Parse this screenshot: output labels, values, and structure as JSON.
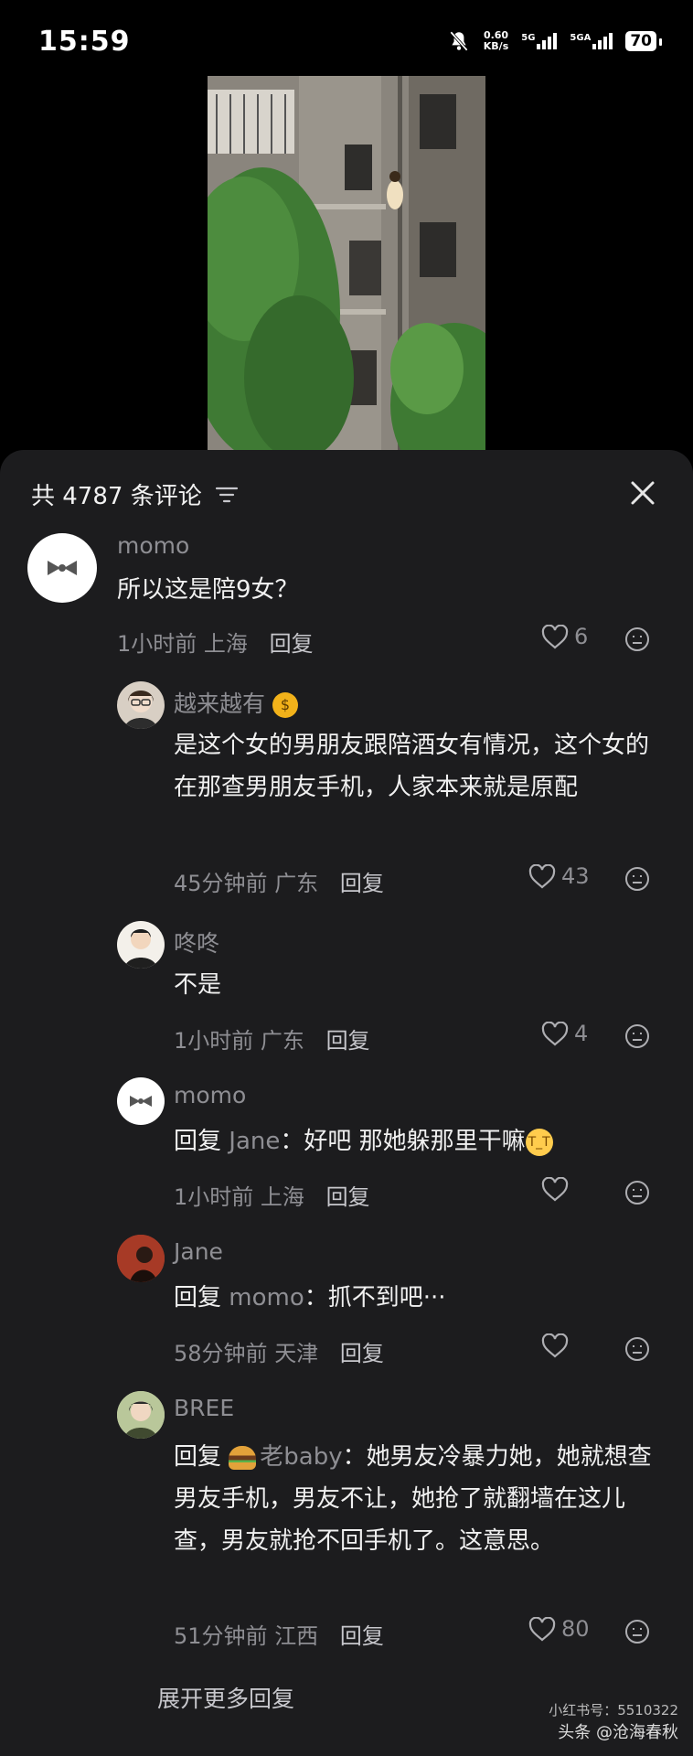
{
  "status_bar": {
    "time": "15:59",
    "net_speed_value": "0.60",
    "net_speed_unit": "KB/s",
    "sim1_label": "5G",
    "sim2_label": "5GA",
    "battery": "70"
  },
  "comments_panel": {
    "title": "共 4787 条评论"
  },
  "comments": [
    {
      "user": "momo",
      "text": "所以这是陪9女？",
      "time": "1小时前",
      "location": "上海",
      "reply_label": "回复",
      "likes": "6"
    },
    {
      "user": "越来越有",
      "text": "是这个女的男朋友跟陪酒女有情况，这个女的在那查男朋友手机，人家本来就是原配",
      "time": "45分钟前",
      "location": "广东",
      "reply_label": "回复",
      "likes": "43"
    },
    {
      "user": "咚咚",
      "text": "不是",
      "time": "1小时前",
      "location": "广东",
      "reply_label": "回复",
      "likes": "4"
    },
    {
      "user": "momo",
      "reply_prefix": "回复",
      "reply_target": "Jane",
      "text": "好吧 那她躲那里干嘛",
      "time": "1小时前",
      "location": "上海",
      "reply_label": "回复",
      "likes": ""
    },
    {
      "user": "Jane",
      "reply_prefix": "回复",
      "reply_target": "momo",
      "text": "抓不到吧···",
      "time": "58分钟前",
      "location": "天津",
      "reply_label": "回复",
      "likes": ""
    },
    {
      "user": "BREE",
      "reply_prefix": "回复",
      "reply_target": "老baby",
      "text": "她男友冷暴力她，她就想查男友手机，男友不让，她抢了就翻墙在这儿查，男友就抢不回手机了。这意思。",
      "time": "51分钟前",
      "location": "江西",
      "reply_label": "回复",
      "likes": "80"
    }
  ],
  "expand_more": "展开更多回复",
  "watermark": {
    "line1": "小红书号：5510322",
    "line2": "头条 @沧海春秋"
  }
}
